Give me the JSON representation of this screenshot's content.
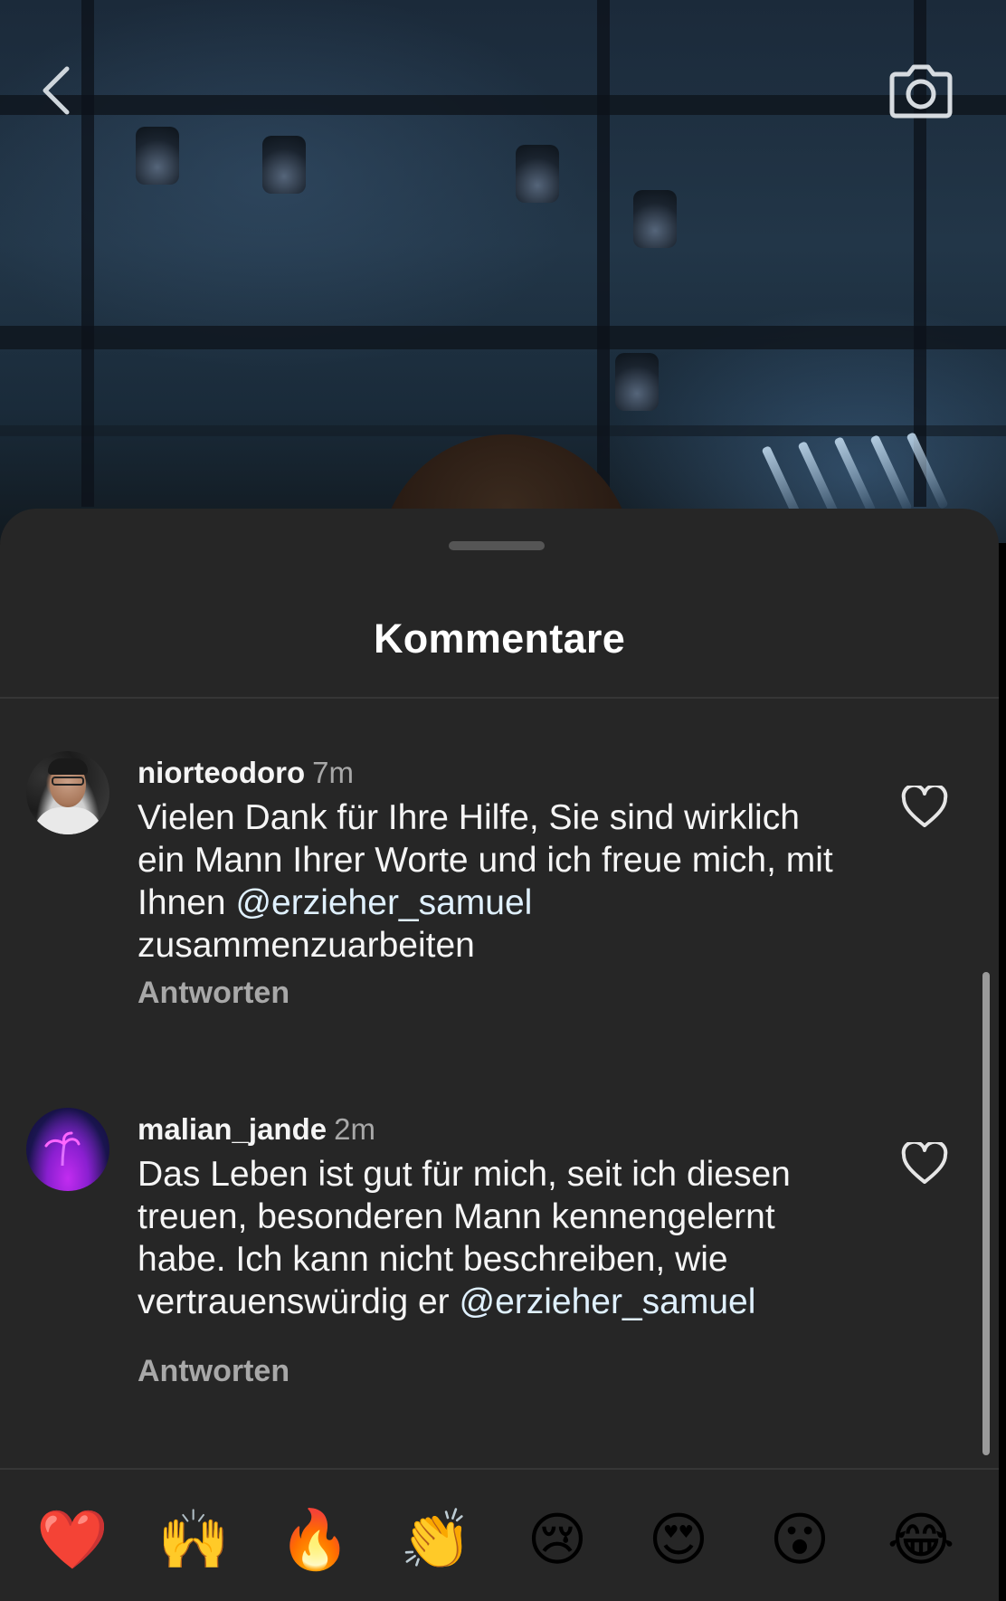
{
  "sheet": {
    "title": "Kommentare"
  },
  "comments": [
    {
      "username": "niorteodoro",
      "time": "7m",
      "text_before": "Vielen Dank für Ihre Hilfe, Sie sind wirklich ein Mann Ihrer Worte und ich freue mich, mit Ihnen ",
      "mention": "@erzieher_samuel",
      "text_after": " zusammenzuarbeiten",
      "reply_label": "Antworten"
    },
    {
      "username": "malian_jande",
      "time": "2m",
      "text_before": "Das Leben ist gut für mich, seit ich diesen treuen, besonderen Mann kennengelernt habe.  Ich kann nicht beschreiben, wie vertrauenswürdig er ",
      "mention": "@erzieher_samuel",
      "text_after": "",
      "reply_label": "Antworten"
    }
  ],
  "emoji_bar": [
    {
      "name": "red-heart",
      "glyph": "❤️"
    },
    {
      "name": "raising-hands",
      "glyph": "🙌"
    },
    {
      "name": "fire",
      "glyph": "🔥"
    },
    {
      "name": "clapping-hands",
      "glyph": "👏"
    },
    {
      "name": "crying-face",
      "glyph": "😢"
    },
    {
      "name": "heart-eyes",
      "glyph": "😍"
    },
    {
      "name": "surprised-face",
      "glyph": "😮"
    },
    {
      "name": "tears-of-joy",
      "glyph": "😂"
    }
  ],
  "icons": {
    "back": "chevron-left-icon",
    "camera": "camera-icon",
    "like": "heart-outline-icon"
  },
  "colors": {
    "sheet_background": "#262626",
    "text_primary": "#f5f5f5",
    "text_secondary": "#a8a8a8",
    "mention": "#e0f1ff"
  }
}
